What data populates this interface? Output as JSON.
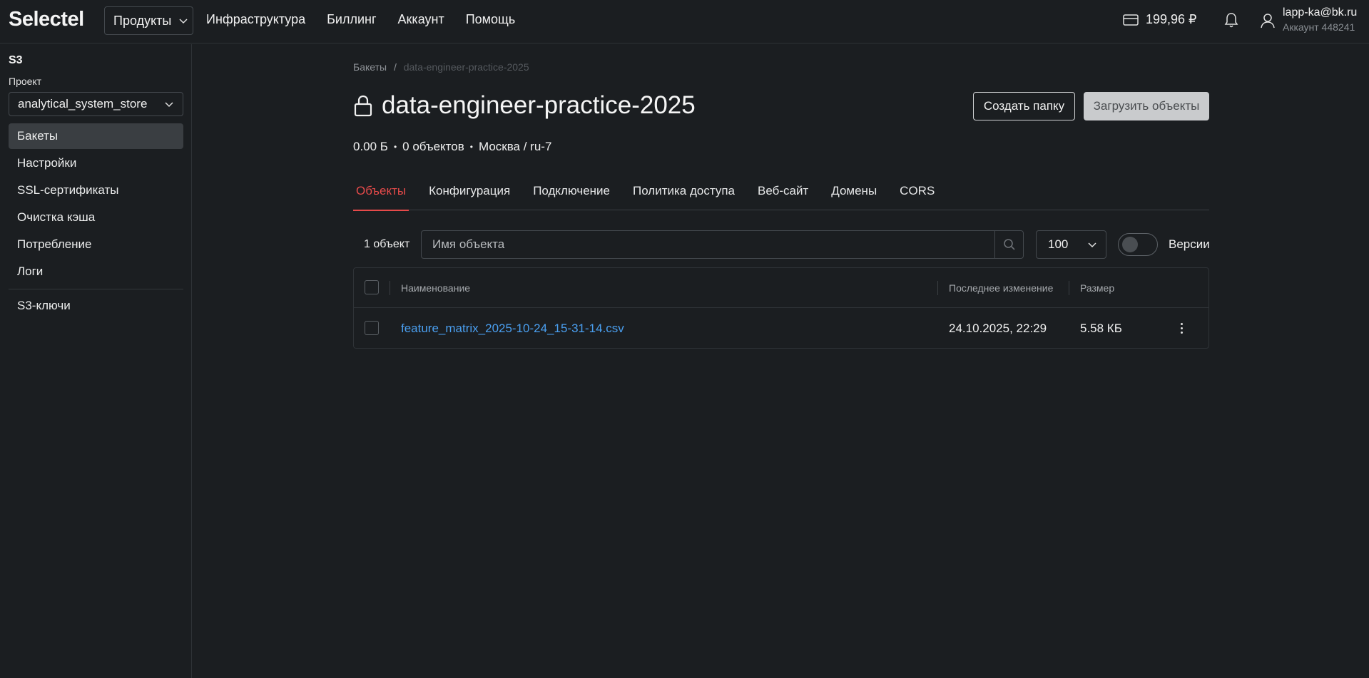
{
  "header": {
    "logo": "Selectel",
    "products_label": "Продукты",
    "nav": [
      "Инфраструктура",
      "Биллинг",
      "Аккаунт",
      "Помощь"
    ],
    "balance": "199,96 ₽",
    "user_email": "lapp-ka@bk.ru",
    "user_account": "Аккаунт 448241"
  },
  "sidebar": {
    "title": "S3",
    "project_label": "Проект",
    "project_value": "analytical_system_store",
    "items": [
      {
        "label": "Бакеты",
        "active": true
      },
      {
        "label": "Настройки"
      },
      {
        "label": "SSL-сертификаты"
      },
      {
        "label": "Очистка кэша"
      },
      {
        "label": "Потребление"
      },
      {
        "label": "Логи"
      }
    ],
    "keys_label": "S3-ключи"
  },
  "main": {
    "breadcrumb_root": "Бакеты",
    "breadcrumb_sep": "/",
    "breadcrumb_current": "data-engineer-practice-2025",
    "title": "data-engineer-practice-2025",
    "create_folder_label": "Создать папку",
    "upload_label": "Загрузить объекты",
    "meta_size": "0.00 Б",
    "meta_objects": "0 объектов",
    "meta_region": "Москва / ru-7",
    "tabs": [
      "Объекты",
      "Конфигурация",
      "Подключение",
      "Политика доступа",
      "Веб-сайт",
      "Домены",
      "CORS"
    ],
    "object_count": "1 объект",
    "search_placeholder": "Имя объекта",
    "per_page": "100",
    "versions_label": "Версии",
    "versions_enabled": false
  },
  "table": {
    "columns": [
      "Наименование",
      "Последнее изменение",
      "Размер"
    ],
    "rows": [
      {
        "name": "feature_matrix_2025-10-24_15-31-14.csv",
        "modified": "24.10.2025, 22:29",
        "size": "5.58 КБ"
      }
    ]
  },
  "colors": {
    "background": "#1b1e21",
    "accent_tab": "#e64a4a",
    "link": "#4a9ff0"
  }
}
